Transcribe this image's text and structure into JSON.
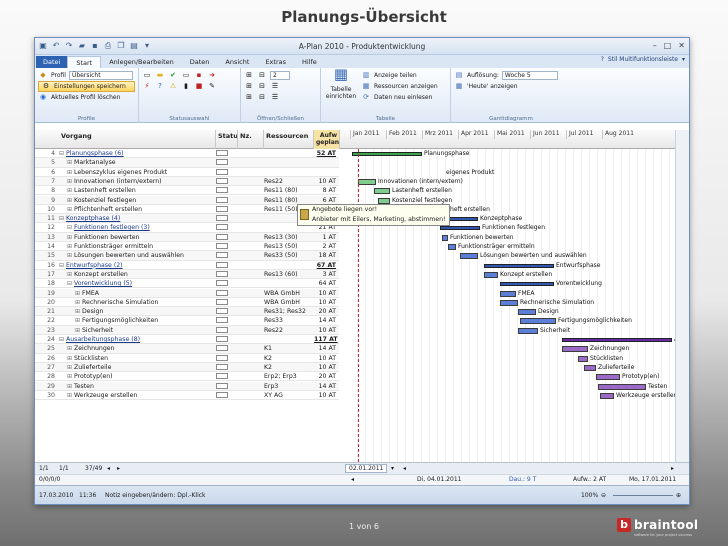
{
  "slide": {
    "title": "Planungs-Übersicht",
    "page": "1 von 6"
  },
  "brand": {
    "name": "braintool",
    "tagline": "software for your project success",
    "icon": "b"
  },
  "window": {
    "title": "A-Plan 2010 - Produktentwicklung"
  },
  "tabs": [
    "Datei",
    "Start",
    "Anlegen/Bearbeiten",
    "Daten",
    "Ansicht",
    "Extras",
    "Hilfe"
  ],
  "tabright": "Stil Multifunktionsleiste",
  "ribbon": {
    "profile_label": "Profil",
    "profile_value": "Übersicht",
    "save_settings": "Einstellungen speichern",
    "reset_profile": "Aktuelles Profil löschen",
    "group_profile": "Profile",
    "group_status": "Statusauswahl",
    "zoom_value": "2",
    "group_open": "Öffnen/Schließen",
    "insert_table": "Tabelle einrichten",
    "show_parts": "Anzeige teilen",
    "show_resources": "Ressourcen anzeigen",
    "reload_data": "Daten neu einlesen",
    "group_table": "Tabelle",
    "resolution_label": "Auflösung:",
    "resolution_value": "Woche 5",
    "today": "'Heute' anzeigen",
    "group_gantt": "Ganttdiagramm"
  },
  "columns": {
    "vorgang": "Vorgang",
    "status": "Status",
    "nz": "Nz.",
    "res": "Ressourcen",
    "aufw": "Aufw geplant"
  },
  "months": [
    "Jan 2011",
    "Feb 2011",
    "Mrz 2011",
    "Apr 2011",
    "Mai 2011",
    "Jun 2011",
    "Jul 2011",
    "Aug 2011"
  ],
  "rows": [
    {
      "n": "4",
      "name": "Planungsphase (6)",
      "phase": true,
      "res": "",
      "aufw": "52 AT"
    },
    {
      "n": "5",
      "name": "Marktanalyse",
      "res": "",
      "aufw": ""
    },
    {
      "n": "6",
      "name": "Lebenszyklus eigenes Produkt",
      "res": "",
      "aufw": ""
    },
    {
      "n": "7",
      "name": "Innovationen (intern/extern)",
      "res": "Res22",
      "aufw": "10 AT"
    },
    {
      "n": "8",
      "name": "Lastenheft erstellen",
      "res": "Res11 (80)",
      "aufw": "8 AT"
    },
    {
      "n": "9",
      "name": "Kostenziel festlegen",
      "res": "Res11 (80)",
      "aufw": "6 AT"
    },
    {
      "n": "10",
      "name": "Pflichtenheft erstellen",
      "res": "Res11 (50)",
      "aufw": "6 AT"
    },
    {
      "n": "11",
      "name": "Konzeptphase (4)",
      "phase": true,
      "res": "",
      "aufw": "26 AT"
    },
    {
      "n": "12",
      "name": "Funktionen festlegen (3)",
      "sub": true,
      "res": "",
      "aufw": "21 AT"
    },
    {
      "n": "13",
      "name": "Funktionen bewerten",
      "res": "Res13 (30)",
      "aufw": "1 AT"
    },
    {
      "n": "14",
      "name": "Funktionsträger ermitteln",
      "res": "Res13 (50)",
      "aufw": "2 AT"
    },
    {
      "n": "15",
      "name": "Lösungen bewerten und auswählen",
      "res": "Res33 (50)",
      "aufw": "18 AT"
    },
    {
      "n": "16",
      "name": "Entwurfsphase (2)",
      "phase": true,
      "res": "",
      "aufw": "67 AT"
    },
    {
      "n": "17",
      "name": "Konzept erstellen",
      "res": "Res13 (60)",
      "aufw": "3 AT"
    },
    {
      "n": "18",
      "name": "Vorentwicklung (5)",
      "sub": true,
      "res": "",
      "aufw": "64 AT"
    },
    {
      "n": "19",
      "name": "FMEA",
      "res": "WBA GmbH",
      "aufw": "10 AT"
    },
    {
      "n": "20",
      "name": "Rechnerische Simulation",
      "res": "WBA GmbH",
      "aufw": "10 AT"
    },
    {
      "n": "21",
      "name": "Design",
      "res": "Res31; Res32",
      "aufw": "20 AT"
    },
    {
      "n": "22",
      "name": "Fertigungsmöglichkeiten",
      "res": "Res33",
      "aufw": "14 AT"
    },
    {
      "n": "23",
      "name": "Sicherheit",
      "res": "Res22",
      "aufw": "10 AT"
    },
    {
      "n": "24",
      "name": "Ausarbeitungsphase (8)",
      "phase": true,
      "res": "",
      "aufw": "117 AT"
    },
    {
      "n": "25",
      "name": "Zeichnungen",
      "res": "K1",
      "aufw": "14 AT"
    },
    {
      "n": "26",
      "name": "Stücklisten",
      "res": "K2",
      "aufw": "10 AT"
    },
    {
      "n": "27",
      "name": "Zulieferteile",
      "res": "K2",
      "aufw": "10 AT"
    },
    {
      "n": "28",
      "name": "Prototyp(en)",
      "res": "Erp2; Erp3",
      "aufw": "20 AT"
    },
    {
      "n": "29",
      "name": "Testen",
      "res": "Erp3",
      "aufw": "14 AT"
    },
    {
      "n": "30",
      "name": "Werkzeuge erstellen",
      "res": "XY AG",
      "aufw": "10 AT"
    }
  ],
  "gantt_labels": {
    "r4": "Planungsphase",
    "r6": "eigenes Produkt",
    "r7": "Innovationen (intern/extern)",
    "r8": "Lastenheft erstellen",
    "r9": "Kostenziel festlegen",
    "r10": "Pflichtenheft erstellen",
    "r11": "Konzeptphase",
    "r12": "Funktionen festlegen",
    "r13": "Funktionen bewerten",
    "r14": "Funktionsträger ermitteln",
    "r15": "Lösungen bewerten und auswählen",
    "r16": "Entwurfsphase",
    "r17": "Konzept erstellen",
    "r18": "Vorentwicklung",
    "r19": "FMEA",
    "r20": "Rechnerische Simulation",
    "r21": "Design",
    "r22": "Fertigungsmöglichkeiten",
    "r23": "Sicherheit",
    "r24": "A",
    "r25": "Zeichnungen",
    "r26": "Stücklisten",
    "r27": "Zulieferteile",
    "r28": "Prototyp(en)",
    "r29": "Testen",
    "r30": "Werkzeuge erstellen"
  },
  "callout": {
    "line1": "Angebote liegen vor!",
    "line2": "Anbieter mit Eilers, Marketing, abstimmen!"
  },
  "footer1": {
    "a": "1/1",
    "b": "1/1",
    "c": "37/49",
    "date": "02.01.2011"
  },
  "footer2": {
    "a": "0/0/0/0",
    "date": "Di, 04.01.2011",
    "dau": "Dau.: 9 T",
    "aufw": "Aufw.: 2 AT",
    "end": "Mo, 17.01.2011"
  },
  "status": {
    "date": "17.03.2010",
    "time": "11:36",
    "note": "Notiz eingeben/ändern: Dpl.-Klick",
    "zoom": "100%"
  }
}
